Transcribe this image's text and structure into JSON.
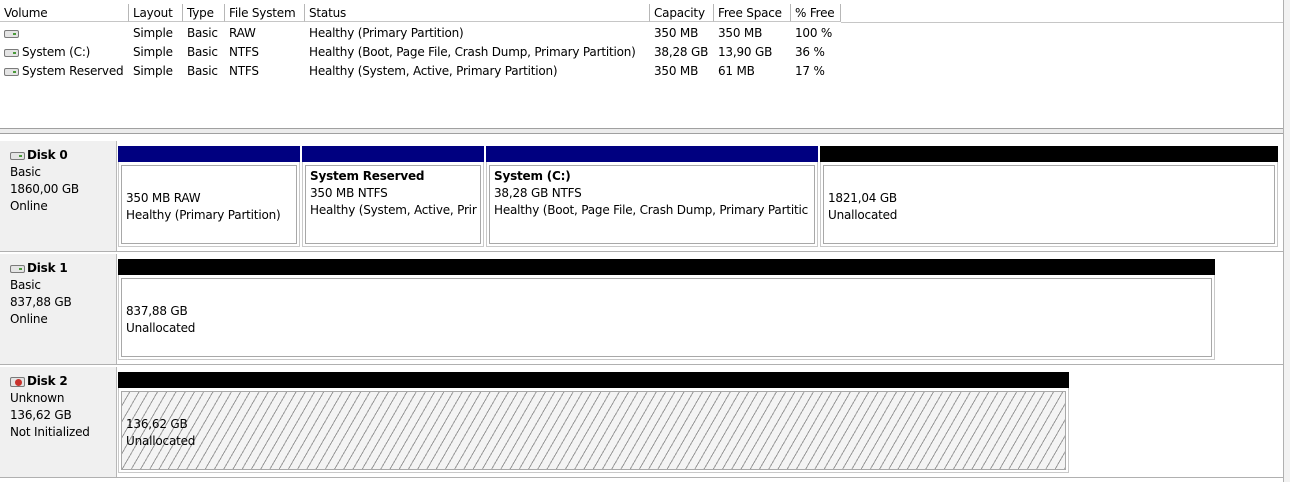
{
  "volume_list": {
    "columns": [
      "Volume",
      "Layout",
      "Type",
      "File System",
      "Status",
      "Capacity",
      "Free Space",
      "% Free"
    ],
    "rows": [
      {
        "volume": "",
        "layout": "Simple",
        "type": "Basic",
        "fs": "RAW",
        "status": "Healthy (Primary Partition)",
        "capacity": "350 MB",
        "free": "350 MB",
        "pct": "100 %"
      },
      {
        "volume": "System (C:)",
        "layout": "Simple",
        "type": "Basic",
        "fs": "NTFS",
        "status": "Healthy (Boot, Page File, Crash Dump, Primary Partition)",
        "capacity": "38,28 GB",
        "free": "13,90 GB",
        "pct": "36 %"
      },
      {
        "volume": "System Reserved",
        "layout": "Simple",
        "type": "Basic",
        "fs": "NTFS",
        "status": "Healthy (System, Active, Primary Partition)",
        "capacity": "350 MB",
        "free": "61 MB",
        "pct": "17 %"
      }
    ]
  },
  "disks": [
    {
      "name": "Disk 0",
      "type": "Basic",
      "size": "1860,00 GB",
      "state": "Online",
      "partitions": [
        {
          "title": "",
          "line1": "350 MB RAW",
          "line2": "Healthy (Primary Partition)",
          "bar_color": "#000080"
        },
        {
          "title": "System Reserved",
          "line1": "350 MB NTFS",
          "line2": "Healthy (System, Active, Prir",
          "bar_color": "#000080"
        },
        {
          "title": "System  (C:)",
          "line1": "38,28 GB NTFS",
          "line2": "Healthy (Boot, Page File, Crash Dump, Primary Partitic",
          "bar_color": "#000080"
        },
        {
          "title": "",
          "line1": "1821,04 GB",
          "line2": "Unallocated",
          "bar_color": "#000000"
        }
      ]
    },
    {
      "name": "Disk 1",
      "type": "Basic",
      "size": "837,88 GB",
      "state": "Online",
      "partitions": [
        {
          "title": "",
          "line1": "837,88 GB",
          "line2": "Unallocated",
          "bar_color": "#000000"
        }
      ]
    },
    {
      "name": "Disk 2",
      "type": "Unknown",
      "size": "136,62 GB",
      "state": "Not Initialized",
      "partitions": [
        {
          "title": "",
          "line1": "136,62 GB",
          "line2": "Unallocated",
          "bar_color": "#000000"
        }
      ]
    }
  ]
}
